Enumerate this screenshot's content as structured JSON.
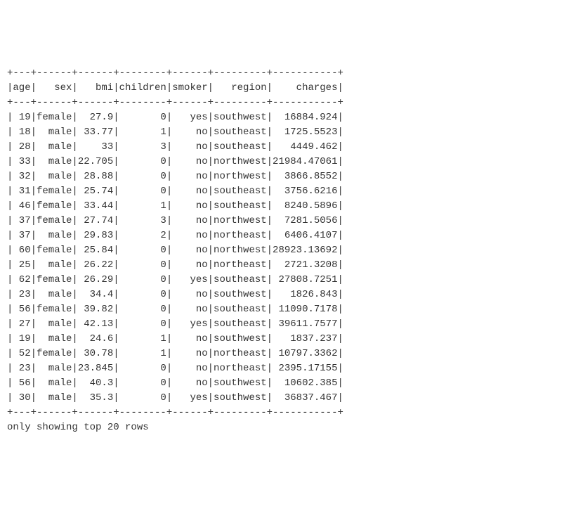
{
  "chart_data": {
    "type": "table",
    "columns": [
      "age",
      "sex",
      "bmi",
      "children",
      "smoker",
      "region",
      "charges"
    ],
    "rows": [
      {
        "age": 19,
        "sex": "female",
        "bmi": 27.9,
        "children": 0,
        "smoker": "yes",
        "region": "southwest",
        "charges": 16884.924
      },
      {
        "age": 18,
        "sex": "male",
        "bmi": 33.77,
        "children": 1,
        "smoker": "no",
        "region": "southeast",
        "charges": 1725.5523
      },
      {
        "age": 28,
        "sex": "male",
        "bmi": 33.0,
        "children": 3,
        "smoker": "no",
        "region": "southeast",
        "charges": 4449.462
      },
      {
        "age": 33,
        "sex": "male",
        "bmi": 22.705,
        "children": 0,
        "smoker": "no",
        "region": "northwest",
        "charges": 21984.47061
      },
      {
        "age": 32,
        "sex": "male",
        "bmi": 28.88,
        "children": 0,
        "smoker": "no",
        "region": "northwest",
        "charges": 3866.8552
      },
      {
        "age": 31,
        "sex": "female",
        "bmi": 25.74,
        "children": 0,
        "smoker": "no",
        "region": "southeast",
        "charges": 3756.6216
      },
      {
        "age": 46,
        "sex": "female",
        "bmi": 33.44,
        "children": 1,
        "smoker": "no",
        "region": "southeast",
        "charges": 8240.5896
      },
      {
        "age": 37,
        "sex": "female",
        "bmi": 27.74,
        "children": 3,
        "smoker": "no",
        "region": "northwest",
        "charges": 7281.5056
      },
      {
        "age": 37,
        "sex": "male",
        "bmi": 29.83,
        "children": 2,
        "smoker": "no",
        "region": "northeast",
        "charges": 6406.4107
      },
      {
        "age": 60,
        "sex": "female",
        "bmi": 25.84,
        "children": 0,
        "smoker": "no",
        "region": "northwest",
        "charges": 28923.13692
      },
      {
        "age": 25,
        "sex": "male",
        "bmi": 26.22,
        "children": 0,
        "smoker": "no",
        "region": "northeast",
        "charges": 2721.3208
      },
      {
        "age": 62,
        "sex": "female",
        "bmi": 26.29,
        "children": 0,
        "smoker": "yes",
        "region": "southeast",
        "charges": 27808.7251
      },
      {
        "age": 23,
        "sex": "male",
        "bmi": 34.4,
        "children": 0,
        "smoker": "no",
        "region": "southwest",
        "charges": 1826.843
      },
      {
        "age": 56,
        "sex": "female",
        "bmi": 39.82,
        "children": 0,
        "smoker": "no",
        "region": "southeast",
        "charges": 11090.7178
      },
      {
        "age": 27,
        "sex": "male",
        "bmi": 42.13,
        "children": 0,
        "smoker": "yes",
        "region": "southeast",
        "charges": 39611.7577
      },
      {
        "age": 19,
        "sex": "male",
        "bmi": 24.6,
        "children": 1,
        "smoker": "no",
        "region": "southwest",
        "charges": 1837.237
      },
      {
        "age": 52,
        "sex": "female",
        "bmi": 30.78,
        "children": 1,
        "smoker": "no",
        "region": "northeast",
        "charges": 10797.3362
      },
      {
        "age": 23,
        "sex": "male",
        "bmi": 23.845,
        "children": 0,
        "smoker": "no",
        "region": "northeast",
        "charges": 2395.17155
      },
      {
        "age": 56,
        "sex": "male",
        "bmi": 40.3,
        "children": 0,
        "smoker": "no",
        "region": "southwest",
        "charges": 10602.385
      },
      {
        "age": 30,
        "sex": "male",
        "bmi": 35.3,
        "children": 0,
        "smoker": "yes",
        "region": "southwest",
        "charges": 36837.467
      }
    ],
    "footer": "only showing top 20 rows"
  },
  "widths": {
    "age": 3,
    "sex": 6,
    "bmi": 6,
    "children": 8,
    "smoker": 6,
    "region": 9,
    "charges": 11
  }
}
